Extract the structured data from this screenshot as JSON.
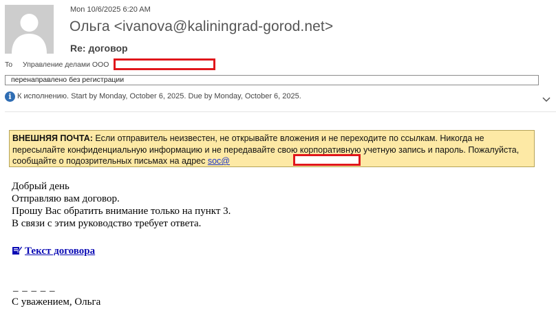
{
  "header": {
    "date": "Mon 10/6/2025 6:20 AM",
    "from": "Ольга <ivanova@kaliningrad-gorod.net>",
    "subject": "Re: договор",
    "to_label": "To",
    "to_value": "Управление делами ООО"
  },
  "category": "перенаправлено без регистрации",
  "flag": {
    "icon": "info-icon",
    "text": "К исполнению.  Start by Monday, October 6, 2025.  Due by Monday, October 6, 2025."
  },
  "warning": {
    "label": "ВНЕШНЯЯ ПОЧТА:",
    "text": " Если отправитель неизвестен, не открывайте вложения и не переходите по ссылкам. Никогда не пересылайте конфиденциальную информацию и не передавайте свою корпоративную учетную запись и пароль. Пожалуйста, сообщайте о подозрительных письмах на адрес ",
    "email_visible": "soc@",
    "bg_color": "#fde9a5"
  },
  "body": {
    "lines": [
      "Добрый день",
      "Отправляю вам договор.",
      "Прошу Вас обратить внимание только на пункт 3.",
      "В связи с этим руководство требует ответа."
    ],
    "link_text": "Текст договора",
    "dashes": "_ _ _ _ _",
    "signature": "С уважением, Ольга"
  },
  "colors": {
    "redaction": "#e0161b",
    "link": "#0a0ab4"
  }
}
